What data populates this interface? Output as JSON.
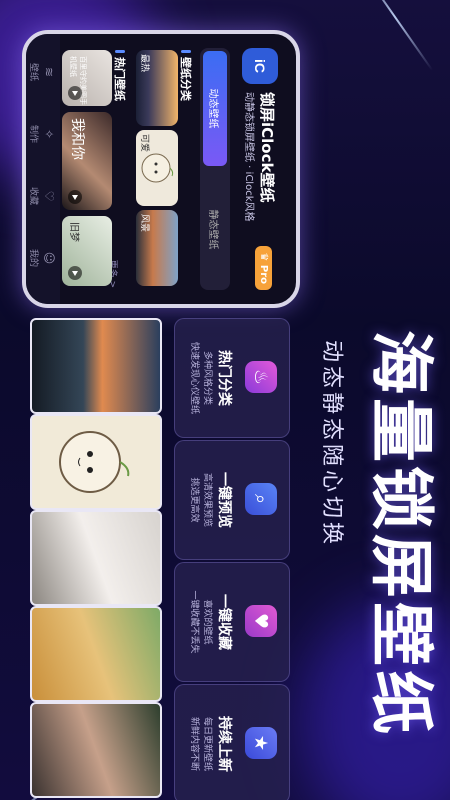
{
  "app": {
    "logo_text": "iC",
    "title": "锁屏iClock壁纸",
    "subtitle": "动静态锁屏壁纸 · iClock风格",
    "pro_badge": "Pro",
    "tabs": [
      "动态壁纸",
      "静态壁纸"
    ],
    "categories_heading": "壁纸分类",
    "categories": [
      "最热",
      "可爱",
      "风景"
    ],
    "hot_heading": "热门壁纸",
    "hot_items": [
      "百里守约美图手机壁纸",
      "我和你",
      "旧梦",
      ""
    ],
    "more_label": "更多 >",
    "nav": [
      {
        "icon": "layers-icon",
        "glyph": "≋",
        "label": "壁纸"
      },
      {
        "icon": "sparkle-icon",
        "glyph": "✧",
        "label": "制作"
      },
      {
        "icon": "heart-icon",
        "glyph": "♡",
        "label": "收藏"
      },
      {
        "icon": "user-icon",
        "glyph": "☺",
        "label": "我的"
      }
    ]
  },
  "headline": "海量锁屏壁纸",
  "subheadline": "动态静态随心切换",
  "features": [
    {
      "title": "热门分类",
      "desc_lines": [
        "多种风格分类",
        "快速发现心仪壁纸"
      ],
      "icon": "flame-icon",
      "glyph": "♨",
      "color": "#d94ad6"
    },
    {
      "title": "一键预览",
      "desc_lines": [
        "高清效果预览",
        "挑选更高效"
      ],
      "icon": "search-icon",
      "glyph": "⌕",
      "color": "#4a6ff0"
    },
    {
      "title": "一键收藏",
      "desc_lines": [
        "喜欢的壁纸",
        "一键收藏不丢失"
      ],
      "icon": "heart-icon",
      "glyph": "♥",
      "color": "#c63fc7"
    },
    {
      "title": "持续上新",
      "desc_lines": [
        "每日更新壁纸",
        "新鲜内容不断"
      ],
      "icon": "star-icon",
      "glyph": "★",
      "color": "#4c5ff0"
    }
  ],
  "strip_photos": [
    "sunset-sea-photo",
    "cartoon-bean-photo",
    "girl-portrait-photo",
    "girl-straw-hat-photo",
    "girl-closeup-photo"
  ]
}
